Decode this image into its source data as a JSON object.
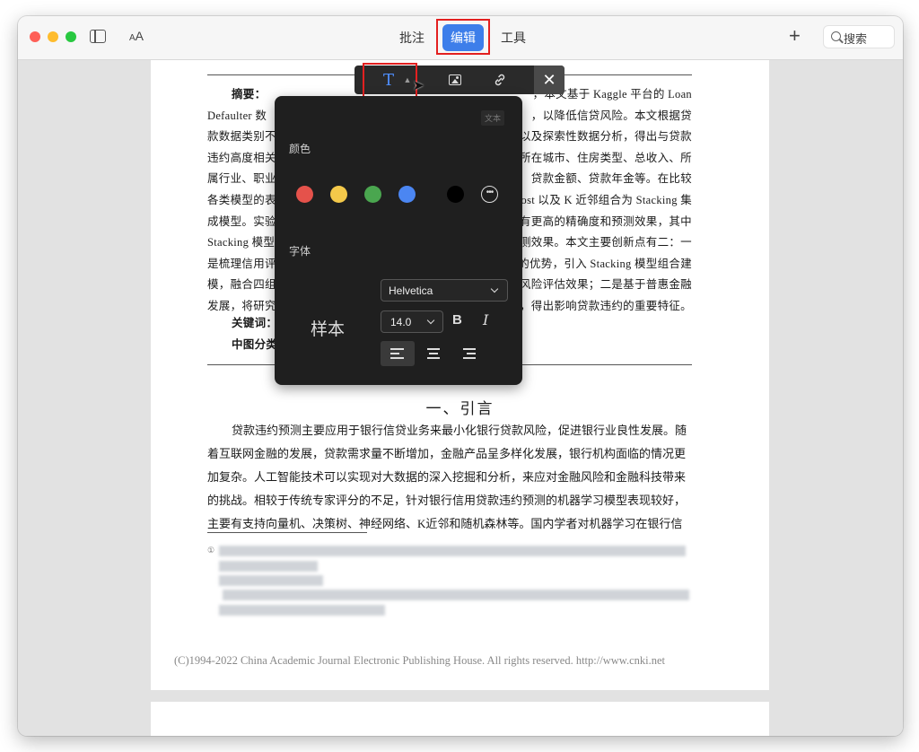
{
  "toolbar": {
    "annotate_label": "批注",
    "edit_label": "编辑",
    "tools_label": "工具",
    "font_size_icon_label": "AA",
    "add_label": "+",
    "search_placeholder": "搜索"
  },
  "edit_bar": {
    "text_tool_glyph": "T",
    "close_glyph": "✕"
  },
  "text_panel": {
    "tag_label": "文本",
    "color_label": "颜色",
    "font_label": "字体",
    "swatches": [
      "#e5524b",
      "#f4c94a",
      "#4aa64f",
      "#4b86f2",
      "#000000"
    ],
    "font_family_value": "Helvetica",
    "font_size_value": "14.0",
    "sample_text": "样本",
    "bold_glyph": "B",
    "italic_glyph": "I"
  },
  "document": {
    "abstract_lines": [
      "摘要：",
      "Defaulter 数",
      "款数据类别不",
      "违约高度相关",
      "属行业、职业",
      "各类模型的表",
      "成模型。实验",
      "Stacking 模型",
      "是梳理信用评",
      "模，融合四组",
      "发展，将研究"
    ],
    "abstract_right": [
      "，本文基于 Kaggle 平台的 Loan",
      "，以降低信贷风险。本文根据贷",
      "以及探索性数据分析，得出与贷款",
      "所在城市、住房类型、总收入、所",
      "贷款金额、贷款年金等。在比较",
      "ost 以及 K 近邻组合为 Stacking 集",
      "有更高的精确度和预测效果，其中",
      "测效果。本文主要创新点有二：一",
      "的优势，引入 Stacking 模型组合建",
      "风险评估效果；二是基于普惠金融",
      "，得出影响贷款违约的重要特征。"
    ],
    "keywords_label": "关键词：",
    "classification_label": "中图分类",
    "section_title": "一、引言",
    "body_lines": [
      "贷款违约预测主要应用于银行信贷业务来最小化银行贷款风险，促进银行业良性发展。随",
      "着互联网金融的发展，贷款需求量不断增加，金融产品呈多样化发展，银行机构面临的情况更",
      "加复杂。人工智能技术可以实现对大数据的深入挖掘和分析，来应对金融风险和金融科技带来",
      "的挑战。相较于传统专家评分的不足，针对银行信用贷款违约预测的机器学习模型表现较好，",
      "主要有支持向量机、决策树、神经网络、K近邻和随机森林等。国内学者对机器学习在银行信"
    ],
    "footnote_mark": "①",
    "copyright": "(C)1994-2022 China Academic Journal Electronic Publishing House. All rights reserved.    http://www.cnki.net"
  }
}
